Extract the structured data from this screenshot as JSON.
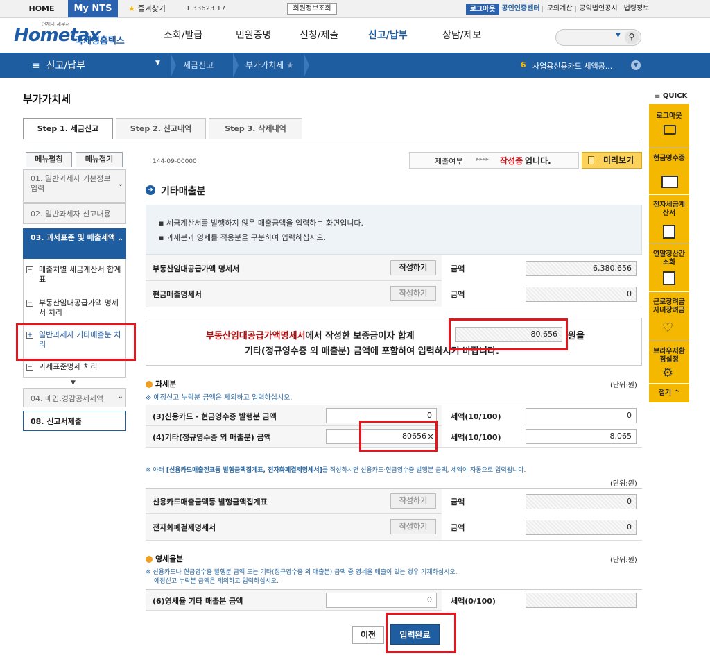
{
  "topbar": {
    "home": "HOME",
    "mynts": "My NTS",
    "bookmark": "즐겨찾기",
    "user_id": "1          33623        17",
    "member_info": "회원정보조회",
    "logout": "로그아웃",
    "cert_center": "공인인증센터",
    "mock_calc": "모의계산",
    "public_corp": "공익법인공시",
    "law_info": "법령정보"
  },
  "header": {
    "logo_small": "언제나 세무서",
    "logo_main": "Hometax",
    "logo_sub": "국세청홈택스",
    "gnb": [
      "조회/발급",
      "민원증명",
      "신청/제출",
      "신고/납부",
      "상담/제보"
    ]
  },
  "navbar": {
    "menu": "신고/납부",
    "crumb1": "세금신고",
    "crumb2": "부가가치세",
    "notice_num": "6",
    "notice_text": "사업용신용카드 세액공..."
  },
  "page": {
    "title": "부가가치세"
  },
  "tabs": [
    "Step 1. 세금신고",
    "Step 2. 신고내역",
    "Step 3. 삭제내역"
  ],
  "left_menu": {
    "expand": "메뉴펼침",
    "collapse": "메뉴접기",
    "items": [
      "01. 일반과세자 기본정보 입력",
      "02. 일반과세자 신고내용",
      "03. 과세표준 및 매출세액",
      "04. 매입.경감공제세액",
      "08. 신고서제출"
    ],
    "subitems": [
      "매출처별 세금계산서 합계표",
      "부동산임대공급가액 명세서 처리",
      "일반과세자 기타매출분 처리",
      "과세표준명세 처리"
    ]
  },
  "status": {
    "biz_no": "144-09-00000",
    "label": "제출여부",
    "arrows": "▸▸▸▸",
    "state": "작성중",
    "state_suffix": "입니다.",
    "preview": "미리보기"
  },
  "section": {
    "title": "기타매출분",
    "info1": "세금계산서를 발행하지 않은 매출금액을 입력하는 화면입니다.",
    "info2": "과세분과 영세를 적용분을 구분하여 입력하십시오."
  },
  "statements": [
    {
      "label": "부동산임대공급가액 명세서",
      "btn": "작성하기",
      "amt_label": "금액",
      "value": "6,380,656"
    },
    {
      "label": "현금매출명세서",
      "btn": "작성하기",
      "amt_label": "금액",
      "value": "0"
    }
  ],
  "notice": {
    "red": "부동산임대공급가액명세서",
    "line1": "에서 작성한 보증금이자 합계",
    "value": "80,656",
    "line1_end": "원을",
    "line2": "기타(정규영수증 외 매출분) 금액에 포함하여 입력하시기 바랍니다."
  },
  "taxable": {
    "title": "과세분",
    "unit": "(단위:원)",
    "note": "※ 예정신고 누락분 금액은 제외하고 입력하십시오.",
    "rows": [
      {
        "label": "(3)신용카드 · 현금영수증 발행분 금액",
        "value": "0",
        "tax_label": "세액(10/100)",
        "tax": "0"
      },
      {
        "label": "(4)기타(정규영수증 외 매출분) 금액",
        "value": "80656",
        "tax_label": "세액(10/100)",
        "tax": "8,065"
      }
    ]
  },
  "card_note": {
    "prefix": "※ 아래 ",
    "bold": "[신용카드매출전표등 발행금액집계표, 전자화폐결제명세서]",
    "suffix": "를 작성하시면 신용카드·현금영수증 발행분 금액, 세액이 자동으로 입력됩니다.",
    "unit": "(단위:원)"
  },
  "card_rows": [
    {
      "label": "신용카드매출금액등 발행금액집계표",
      "btn": "작성하기",
      "amt_label": "금액",
      "value": "0"
    },
    {
      "label": "전자화폐결제명세서",
      "btn": "작성하기",
      "amt_label": "금액",
      "value": "0"
    }
  ],
  "zero": {
    "title": "영세율분",
    "unit": "(단위:원)",
    "note1": "※ 신용카드나 현금영수증 발행분 금액 또는 기타(정규영수증 외 매출분) 금액 중 영세율 매출이 있는 경우 기재하십시오.",
    "note2": "예정신고 누락분 금액은 제외하고 입력하십시오.",
    "row_label": "(6)영세율 기타 매출분 금액",
    "value": "0",
    "tax_label": "세액(0/100)"
  },
  "buttons": {
    "prev": "이전",
    "complete": "입력완료"
  },
  "quick": {
    "title": "QUICK",
    "items": [
      "로그아웃",
      "현금영수증",
      "전자세금계산서",
      "연말정산간소화",
      "근로장려금자녀장려금",
      "브라우저환경설정"
    ],
    "fold": "접기"
  },
  "colors": {
    "brand": "#1f5da1",
    "highlight": "#e3151e",
    "quick": "#f5b800"
  }
}
